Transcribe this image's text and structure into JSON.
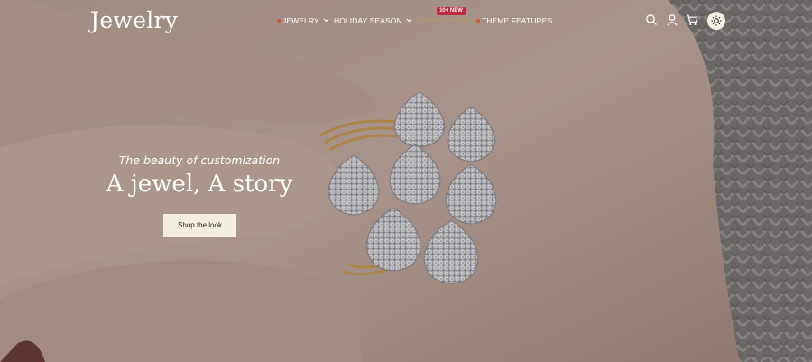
{
  "brand": {
    "logo_text": "Jewelry"
  },
  "nav": {
    "items": [
      {
        "label": "JEWELRY",
        "has_dropdown": true
      },
      {
        "label": "HOLIDAY SEASON",
        "has_dropdown": true
      },
      {
        "label": "SHOP DEMOS",
        "has_dropdown": false
      },
      {
        "label": "THEME FEATURES",
        "has_dropdown": false
      }
    ],
    "badge": "10+ NEW"
  },
  "header_icons": [
    "search-icon",
    "account-icon",
    "cart-icon",
    "sun-icon"
  ],
  "hero": {
    "tagline": "The beauty of customization",
    "headline": "A jewel, A story",
    "cta_label": "Shop the look"
  },
  "colors": {
    "badge": "#c0283c",
    "cta_background": "#f4ede2",
    "nav_text": "#ffffff",
    "nav_mark": "#d4582c",
    "demos_text": "#c9a24a"
  }
}
